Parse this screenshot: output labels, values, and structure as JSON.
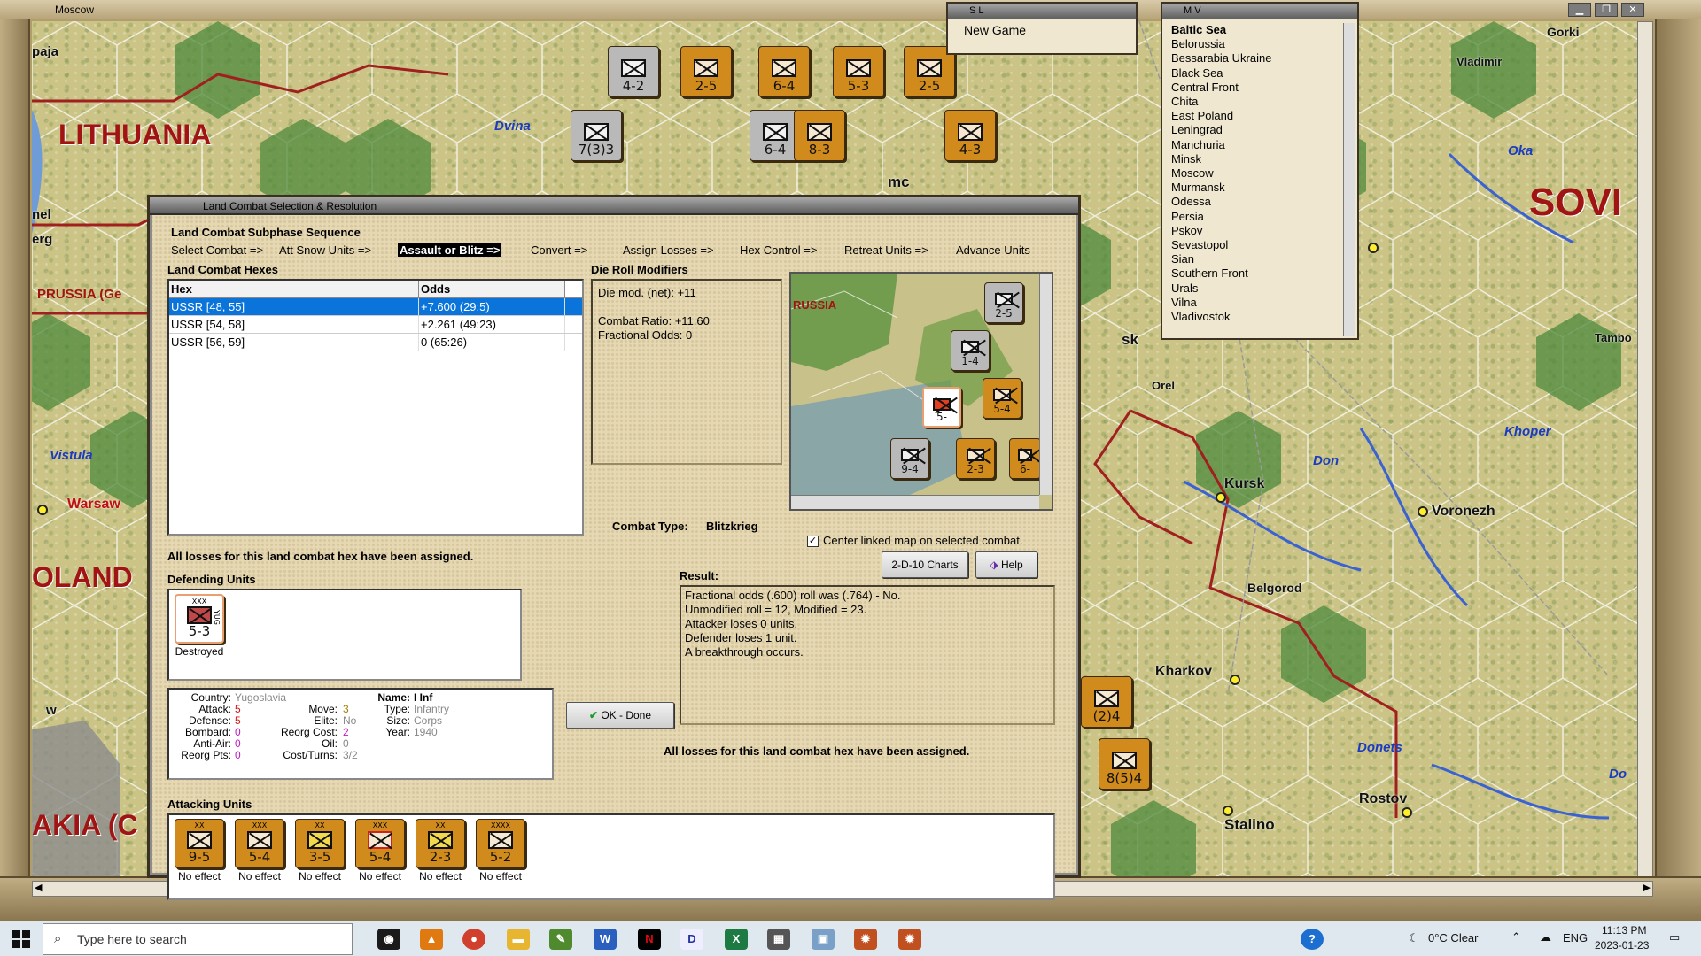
{
  "window": {
    "title": "Moscow"
  },
  "sl_window": {
    "title": "S L",
    "item": "New Game"
  },
  "mv_window": {
    "title": "M V",
    "items": [
      "Baltic Sea",
      "Belorussia",
      "Bessarabia Ukraine",
      "Black Sea",
      "Central Front",
      "Chita",
      "East Poland",
      "Leningrad",
      "Manchuria",
      "Minsk",
      "Moscow",
      "Murmansk",
      "Odessa",
      "Persia",
      "Pskov",
      "Sevastopol",
      "Sian",
      "Southern Front",
      "Urals",
      "Vilna",
      "Vladivostok"
    ]
  },
  "map": {
    "countries": [
      "LITHUANIA",
      "PRUSSIA (Ge",
      "OLAND",
      "AKIA (C",
      "SOVI"
    ],
    "cities": [
      "Warsaw",
      "Kursk",
      "Voronezh",
      "Belgorod",
      "Kharkov",
      "Stalino",
      "Rostov",
      "Orel",
      "Vladimir",
      "Gorki",
      "Tambo"
    ],
    "rivers": [
      "Dvina",
      "Vistula",
      "Oka",
      "Don",
      "Khoper",
      "Donets",
      "Do"
    ],
    "partial_labels": [
      "paja",
      "nel",
      "erg",
      "sk",
      "mc",
      "w"
    ]
  },
  "map_counters": [
    {
      "str": "4-2",
      "side": "axis"
    },
    {
      "str": "2-5",
      "side": "soviet"
    },
    {
      "str": "6-4",
      "side": "soviet"
    },
    {
      "str": "5-3",
      "side": "soviet"
    },
    {
      "str": "2-5",
      "side": "soviet"
    },
    {
      "str": "7(3)3",
      "side": "axis"
    },
    {
      "str": "6-4",
      "side": "axis"
    },
    {
      "str": "8-3",
      "side": "soviet"
    },
    {
      "str": "4-3",
      "side": "soviet"
    },
    {
      "str": "8(5)4",
      "side": "soviet"
    },
    {
      "str": "(2)4",
      "side": "soviet"
    }
  ],
  "dialog": {
    "title": "Land Combat Selection & Resolution",
    "sequence_title": "Land Combat Subphase Sequence",
    "sequence": [
      "Select Combat =>",
      "Att Snow Units =>",
      "Assault or Blitz =>",
      "Convert =>",
      "Assign Losses =>",
      "Hex Control =>",
      "Retreat Units =>",
      "Advance Units"
    ],
    "active_step": "Assault or Blitz =>",
    "hexes_title": "Land Combat Hexes",
    "table_headers": [
      "Hex",
      "Odds"
    ],
    "hexes": [
      {
        "hex": "USSR [48, 55]",
        "odds": "+7.600 (29:5)",
        "selected": true
      },
      {
        "hex": "USSR [54, 58]",
        "odds": "+2.261 (49:23)",
        "selected": false
      },
      {
        "hex": "USSR [56, 59]",
        "odds": "0 (65:26)",
        "selected": false
      }
    ],
    "modifiers_title": "Die Roll Modifiers",
    "modifiers": [
      "Die mod. (net): +11",
      "",
      "Combat Ratio: +11.60",
      "Fractional Odds: 0"
    ],
    "combat_type_label": "Combat Type:",
    "combat_type": "Blitzkrieg",
    "center_map_label": "Center linked map on selected combat.",
    "center_map_checked": true,
    "charts_button": "2-D-10 Charts",
    "help_button": "Help",
    "losses_msg": "All losses for this land combat hex have been assigned.",
    "result_title": "Result:",
    "result_lines": [
      "Fractional odds (.600) roll was (.764)  - No.",
      "Unmodified roll = 12, Modified = 23.",
      "Attacker loses 0 units.",
      "Defender loses 1 unit.",
      "A breakthrough occurs."
    ],
    "ok_button": "OK - Done",
    "defending_title": "Defending Units",
    "defender": {
      "str": "5-3",
      "status": "Destroyed",
      "label": "YUG"
    },
    "unit_info": {
      "country_label": "Country:",
      "country": "Yugoslavia",
      "attack_label": "Attack:",
      "attack": "5",
      "defense_label": "Defense:",
      "defense": "5",
      "bombard_label": "Bombard:",
      "bombard": "0",
      "antiair_label": "Anti-Air:",
      "antiair": "0",
      "reorgpts_label": "Reorg Pts:",
      "reorgpts": "0",
      "move_label": "Move:",
      "move": "3",
      "elite_label": "Elite:",
      "elite": "No",
      "reorgcost_label": "Reorg Cost:",
      "reorgcost": "2",
      "oil_label": "Oil:",
      "oil": "0",
      "costturns_label": "Cost/Turns:",
      "costturns": "3/2",
      "name_label": "Name:",
      "name": "I Inf",
      "type_label": "Type:",
      "type": "Infantry",
      "size_label": "Size:",
      "size": "Corps",
      "year_label": "Year:",
      "year": "1940"
    },
    "attacking_title": "Attacking Units",
    "attackers": [
      {
        "str": "9-5",
        "status": "No effect"
      },
      {
        "str": "5-4",
        "status": "No effect"
      },
      {
        "str": "3-5",
        "status": "No effect"
      },
      {
        "str": "5-4",
        "status": "No effect"
      },
      {
        "str": "2-3",
        "status": "No effect"
      },
      {
        "str": "5-2",
        "status": "No effect"
      }
    ],
    "minimap_counters": [
      "2-5",
      "1-4",
      "5-4",
      "5-",
      "9-4",
      "2-3",
      "6-",
      "RUSSIA"
    ]
  },
  "taskbar": {
    "search_placeholder": "Type here to search",
    "weather": "0°C  Clear",
    "lang": "ENG",
    "time": "11:13 PM",
    "date": "2023-01-23"
  }
}
